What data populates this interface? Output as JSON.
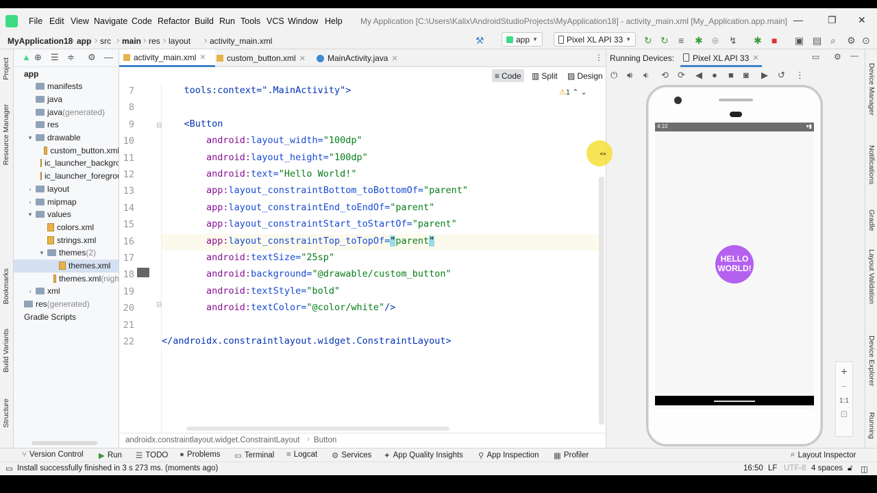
{
  "menubar": {
    "items": [
      "File",
      "Edit",
      "View",
      "Navigate",
      "Code",
      "Refactor",
      "Build",
      "Run",
      "Tools",
      "VCS",
      "Window",
      "Help"
    ],
    "title": "My Application [C:\\Users\\Kalix\\AndroidStudioProjects\\MyApplication18] - activity_main.xml [My_Application.app.main]"
  },
  "breadcrumbs": [
    "MyApplication18",
    "app",
    "src",
    "main",
    "res",
    "layout",
    "activity_main.xml"
  ],
  "run_config": {
    "module": "app",
    "device": "Pixel XL API 33"
  },
  "left_tools": {
    "project": "Project",
    "resource_manager": "Resource Manager",
    "bookmarks": "Bookmarks",
    "build_variants": "Build Variants",
    "structure": "Structure"
  },
  "project_tree": [
    {
      "label": "app",
      "indent": 0,
      "arrow": "",
      "icon": "none",
      "bold": true
    },
    {
      "label": "manifests",
      "indent": 1,
      "arrow": "",
      "icon": "folder"
    },
    {
      "label": "java",
      "indent": 1,
      "arrow": "",
      "icon": "folder"
    },
    {
      "label": "java",
      "suffix": " (generated)",
      "indent": 1,
      "arrow": "",
      "icon": "folder"
    },
    {
      "label": "res",
      "indent": 1,
      "arrow": "",
      "icon": "folder"
    },
    {
      "label": "drawable",
      "indent": 1,
      "arrow": "▾",
      "icon": "folder"
    },
    {
      "label": "custom_button.xml",
      "indent": 2,
      "arrow": "",
      "icon": "file"
    },
    {
      "label": "ic_launcher_backgro",
      "indent": 2,
      "arrow": "",
      "icon": "file"
    },
    {
      "label": "ic_launcher_foregrou",
      "indent": 2,
      "arrow": "",
      "icon": "file"
    },
    {
      "label": "layout",
      "indent": 1,
      "arrow": "›",
      "icon": "folder"
    },
    {
      "label": "mipmap",
      "indent": 1,
      "arrow": "›",
      "icon": "folder"
    },
    {
      "label": "values",
      "indent": 1,
      "arrow": "▾",
      "icon": "folder"
    },
    {
      "label": "colors.xml",
      "indent": 2,
      "arrow": "",
      "icon": "file"
    },
    {
      "label": "strings.xml",
      "indent": 2,
      "arrow": "",
      "icon": "file"
    },
    {
      "label": "themes",
      "suffix": " (2)",
      "indent": 2,
      "arrow": "▾",
      "icon": "folder"
    },
    {
      "label": "themes.xml",
      "indent": 3,
      "arrow": "",
      "icon": "file",
      "selected": true
    },
    {
      "label": "themes.xml",
      "suffix": " (nigh",
      "indent": 3,
      "arrow": "",
      "icon": "file"
    },
    {
      "label": "xml",
      "indent": 1,
      "arrow": "›",
      "icon": "folder"
    },
    {
      "label": "res",
      "suffix": " (generated)",
      "indent": 0,
      "arrow": "",
      "icon": "folder"
    },
    {
      "label": "Gradle Scripts",
      "indent": 0,
      "arrow": "",
      "icon": "none"
    }
  ],
  "tabs": [
    {
      "label": "activity_main.xml",
      "active": true
    },
    {
      "label": "custom_button.xml",
      "active": false
    },
    {
      "label": "MainActivity.java",
      "active": false
    }
  ],
  "modes": {
    "code": "Code",
    "split": "Split",
    "design": "Design"
  },
  "warning_count": "1",
  "code_lines": [
    {
      "n": "7",
      "segs": [
        [
          "    ",
          ""
        ],
        [
          "tools:context=\".MainActivity\">",
          "tag"
        ]
      ]
    },
    {
      "n": "8",
      "segs": []
    },
    {
      "n": "9",
      "segs": [
        [
          "    ",
          ""
        ],
        [
          "<Button",
          "tag"
        ]
      ]
    },
    {
      "n": "10",
      "segs": [
        [
          "        ",
          ""
        ],
        [
          "android:",
          "ns"
        ],
        [
          "layout_width=",
          "attr"
        ],
        [
          "\"100dp\"",
          "val"
        ]
      ]
    },
    {
      "n": "11",
      "segs": [
        [
          "        ",
          ""
        ],
        [
          "android:",
          "ns"
        ],
        [
          "layout_height=",
          "attr"
        ],
        [
          "\"100dp\"",
          "val"
        ]
      ]
    },
    {
      "n": "12",
      "segs": [
        [
          "        ",
          ""
        ],
        [
          "android:",
          "ns"
        ],
        [
          "text=",
          "attr"
        ],
        [
          "\"Hello World!\"",
          "val"
        ]
      ]
    },
    {
      "n": "13",
      "segs": [
        [
          "        ",
          ""
        ],
        [
          "app:",
          "ns"
        ],
        [
          "layout_constraintBottom_toBottomOf=",
          "attr"
        ],
        [
          "\"parent\"",
          "val"
        ]
      ]
    },
    {
      "n": "14",
      "segs": [
        [
          "        ",
          ""
        ],
        [
          "app:",
          "ns"
        ],
        [
          "layout_constraintEnd_toEndOf=",
          "attr"
        ],
        [
          "\"parent\"",
          "val"
        ]
      ]
    },
    {
      "n": "15",
      "segs": [
        [
          "        ",
          ""
        ],
        [
          "app:",
          "ns"
        ],
        [
          "layout_constraintStart_toStartOf=",
          "attr"
        ],
        [
          "\"parent\"",
          "val"
        ]
      ]
    },
    {
      "n": "16",
      "current": true,
      "segs": [
        [
          "        ",
          ""
        ],
        [
          "app:",
          "ns"
        ],
        [
          "layout_constraintTop_toTopOf=",
          "attr"
        ],
        [
          "\"",
          "brace"
        ],
        [
          "parent",
          "val"
        ],
        [
          "\"",
          "brace"
        ]
      ]
    },
    {
      "n": "17",
      "segs": [
        [
          "        ",
          ""
        ],
        [
          "android:",
          "ns"
        ],
        [
          "textSize=",
          "attr"
        ],
        [
          "\"25sp\"",
          "val"
        ]
      ]
    },
    {
      "n": "18",
      "segs": [
        [
          "        ",
          ""
        ],
        [
          "android:",
          "ns"
        ],
        [
          "background=",
          "attr"
        ],
        [
          "\"@drawable/custom_button\"",
          "val"
        ]
      ]
    },
    {
      "n": "19",
      "segs": [
        [
          "        ",
          ""
        ],
        [
          "android:",
          "ns"
        ],
        [
          "textStyle=",
          "attr"
        ],
        [
          "\"bold\"",
          "val"
        ]
      ]
    },
    {
      "n": "20",
      "segs": [
        [
          "        ",
          ""
        ],
        [
          "android:",
          "ns"
        ],
        [
          "textColor=",
          "attr"
        ],
        [
          "\"@color/white\"",
          "val"
        ],
        [
          "/>",
          "tag"
        ]
      ]
    },
    {
      "n": "21",
      "segs": []
    },
    {
      "n": "22",
      "segs": [
        [
          "",
          ""
        ],
        [
          "</androidx.constraintlayout.widget.ConstraintLayout>",
          "tag"
        ]
      ]
    }
  ],
  "editor_footer": {
    "path1": "androidx.constraintlayout.widget.ConstraintLayout",
    "path2": "Button"
  },
  "running_devices": {
    "label": "Running Devices:",
    "device_tab": "Pixel XL API 33"
  },
  "phone": {
    "status_time": "4:10",
    "button_text": "HELLO WORLD!"
  },
  "zoom": {
    "plus": "+",
    "minus": "−",
    "ratio": "1:1"
  },
  "right_tools": {
    "device_manager": "Device Manager",
    "notifications": "Notifications",
    "gradle": "Gradle",
    "layout_validation": "Layout Validation",
    "device_explorer": "Device Explorer",
    "running": "Running"
  },
  "bottom_tools": [
    "Version Control",
    "Run",
    "TODO",
    "Problems",
    "Terminal",
    "Logcat",
    "Services",
    "App Quality Insights",
    "App Inspection",
    "Profiler"
  ],
  "layout_inspector": "Layout Inspector",
  "status": {
    "message": "Install successfully finished in 3 s 273 ms. (moments ago)",
    "position": "16:50",
    "line_sep": "LF",
    "encoding": "UTF-8",
    "indent": "4 spaces"
  },
  "colors": {
    "accent": "#4083c9",
    "button": "#b561f0",
    "android_green": "#3ddc84"
  }
}
